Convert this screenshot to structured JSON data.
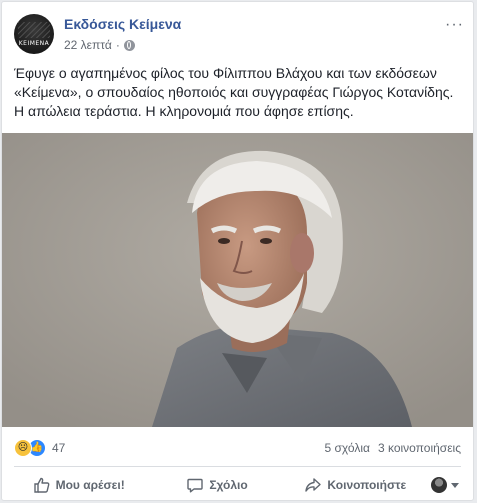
{
  "post": {
    "page_name": "Εκδόσεις Κείμενα",
    "avatar_logo": "ΚΕΙΜΕΝΑ",
    "time": "22 λεπτά",
    "privacy_icon": "globe-icon",
    "more_label": "···",
    "text": "Έφυγε ο αγαπημένος φίλος του Φίλιππου Βλάχου και των εκδόσεων «Κείμενα», ο σπουδαίος ηθοποιός και συγγραφέας Γιώργος Κοτανίδης. Η απώλεια τεράστια. Η κληρονομιά που άφησε επίσης."
  },
  "reactions": {
    "icons": [
      "sad-reaction-icon",
      "like-reaction-icon"
    ],
    "count": "47",
    "comments": "5 σχόλια",
    "shares": "3 κοινοποιήσεις"
  },
  "actions": {
    "like_label": "Μου αρέσει!",
    "comment_label": "Σχόλιο",
    "share_label": "Κοινοποιήστε"
  },
  "colors": {
    "page_link": "#385898",
    "secondary_text": "#606770",
    "like_blue": "#2d88ff",
    "sad_yellow": "#f7c23c"
  }
}
